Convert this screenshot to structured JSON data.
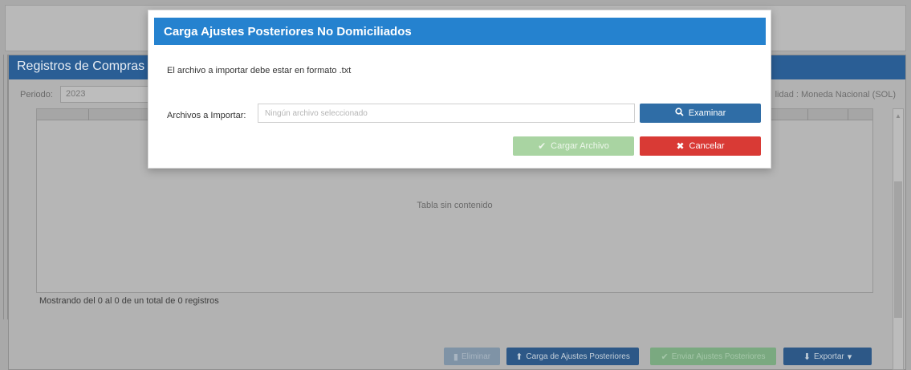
{
  "background": {
    "panel_title": "Registros de Compras",
    "period_label": "Periodo:",
    "period_value": "2023",
    "currency_label": "lidad : Moneda Nacional (SOL)",
    "table_empty_text": "Tabla sin contenido",
    "records_info": "Mostrando del 0 al 0 de un total de 0 registros",
    "buttons": {
      "eliminar": "Eliminar",
      "carga_ajustes": "Carga de Ajustes Posteriores",
      "enviar_ajustes": "Enviar Ajustes Posteriores",
      "exportar": "Exportar"
    }
  },
  "modal": {
    "title": "Carga Ajustes Posteriores No Domiciliados",
    "note": "El archivo a importar debe estar en formato .txt",
    "file_label": "Archivos a Importar:",
    "file_placeholder": "Ningún archivo seleccionado",
    "buttons": {
      "examinar": "Examinar",
      "cargar_archivo": "Cargar Archivo",
      "cancelar": "Cancelar"
    }
  },
  "icons": {
    "search": "search-icon",
    "check": "check-icon",
    "close": "close-icon",
    "upload": "upload-icon",
    "download": "download-icon",
    "trash": "trash-icon",
    "caret": "caret-down-icon"
  },
  "colors": {
    "modal_header": "#2582cf",
    "primary": "#2f6da6",
    "success": "#a9d4a2",
    "danger": "#d93a35",
    "panel_header": "#2a5e95"
  }
}
